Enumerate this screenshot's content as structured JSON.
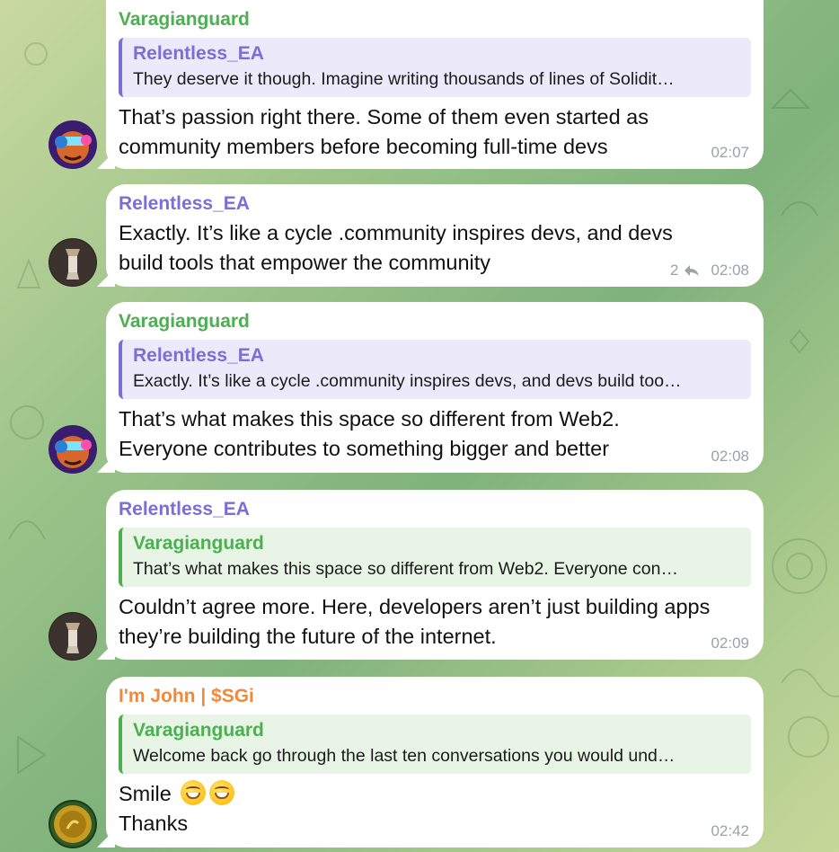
{
  "colors": {
    "green_name": "#4caf50",
    "purple_name": "#7a6fd6",
    "orange_name": "#ef8a3c",
    "reply_purple_bg": "#ece9fb",
    "reply_green_bg": "#e8f5e6"
  },
  "messages": [
    {
      "sender": "Varagianguard",
      "reply_name": "Relentless_EA",
      "reply_text": "They deserve it though. Imagine writing thousands of lines of Solidit…",
      "text_lines": [
        "That’s passion right there. Some of them even started as",
        "community members before becoming full-time devs"
      ],
      "time": "02:07"
    },
    {
      "sender": "Relentless_EA",
      "text_lines": [
        "Exactly. It’s like a cycle .community inspires devs, and devs",
        "build tools that empower the community"
      ],
      "reply_count": "2",
      "time": "02:08"
    },
    {
      "sender": "Varagianguard",
      "reply_name": "Relentless_EA",
      "reply_text": "Exactly. It’s like a cycle .community inspires devs, and devs build too…",
      "text_lines": [
        "That’s what makes this space so different from Web2.",
        "Everyone contributes to something bigger and better"
      ],
      "time": "02:08"
    },
    {
      "sender": "Relentless_EA",
      "reply_name": "Varagianguard",
      "reply_text": "That’s what makes this space so different from Web2. Everyone con…",
      "text_lines": [
        "Couldn’t agree more. Here, developers aren’t just building apps",
        "they’re building the future of the internet."
      ],
      "time": "02:09"
    },
    {
      "sender": "I'm John | $SGi",
      "reply_name": "Varagianguard",
      "reply_text": "Welcome back go through the last ten conversations you would und…",
      "text_lines": [
        "Smile",
        "Thanks"
      ],
      "time": "02:42"
    }
  ]
}
